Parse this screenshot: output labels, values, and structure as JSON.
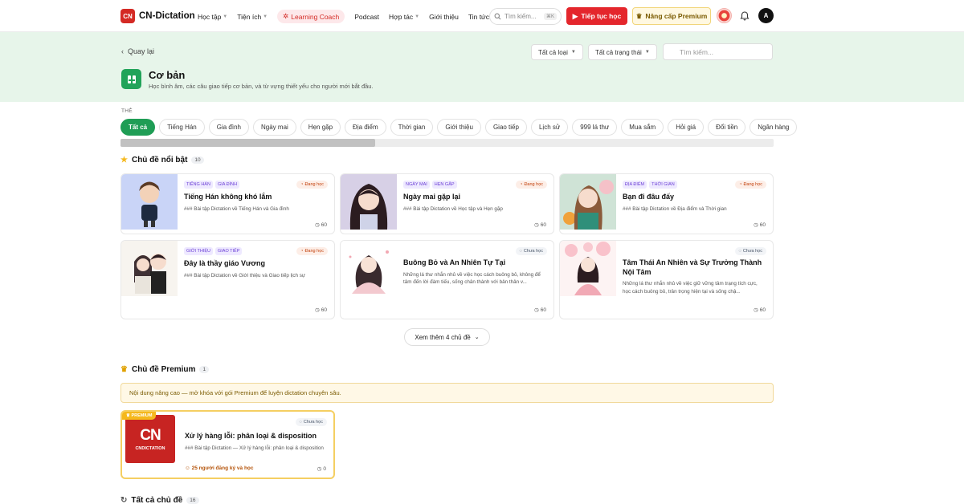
{
  "header": {
    "logo_mark": "CN",
    "brand": "CN-Dictation",
    "nav": [
      "Học tập",
      "Tiện ích",
      "Learning Coach",
      "Podcast",
      "Hợp tác",
      "Giới thiệu",
      "Tin tức"
    ],
    "search_placeholder": "Tìm kiếm...",
    "search_shortcut": "⌘K",
    "continue_label": "Tiếp tục học",
    "premium_label": "Nâng cấp Premium",
    "avatar_letter": "A"
  },
  "hero": {
    "back_label": "Quay lại",
    "filter_type": "Tất cả loại",
    "filter_status": "Tất cả trạng thái",
    "search_placeholder": "Tìm kiếm...",
    "title": "Cơ bản",
    "description": "Học bình âm, các câu giao tiếp cơ bản, và từ vựng thiết yếu cho người mới bắt đầu.",
    "accent": "#22a35a"
  },
  "tags": {
    "label": "THẺ",
    "items": [
      "Tất cả",
      "Tiếng Hán",
      "Gia đình",
      "Ngày mai",
      "Hẹn gặp",
      "Địa điểm",
      "Thời gian",
      "Giới thiệu",
      "Giao tiếp",
      "Lịch sử",
      "999 lá thư",
      "Mua sắm",
      "Hỏi giá",
      "Đổi tiền",
      "Ngân hàng"
    ]
  },
  "featured": {
    "title": "Chủ đề nổi bật",
    "count": "10",
    "cards": [
      {
        "chips": [
          "TIẾNG HÁN",
          "GIA ĐÌNH"
        ],
        "status": "Đang học",
        "title": "Tiếng Hán không khó lắm",
        "desc": "### Bài tập Dictation về Tiếng Hán và Gia đình",
        "count": "60"
      },
      {
        "chips": [
          "NGÀY MAI",
          "HẸN GẶP"
        ],
        "status": "Đang học",
        "title": "Ngày mai gặp lại",
        "desc": "### Bài tập Dictation về Học tập và Hẹn gặp",
        "count": "60"
      },
      {
        "chips": [
          "ĐỊA ĐIỂM",
          "THỜI GIAN"
        ],
        "status": "Đang học",
        "title": "Bạn đi đâu đấy",
        "desc": "### Bài tập Dictation về Địa điểm và Thời gian",
        "count": "60"
      },
      {
        "chips": [
          "GIỚI THIỆU",
          "GIAO TIẾP"
        ],
        "status": "Đang học",
        "title": "Đây là thầy giáo Vương",
        "desc": "### Bài tập Dictation về Giới thiệu và Giao tiếp lịch sự",
        "count": "60"
      },
      {
        "chips": [],
        "status": "Chưa học",
        "title": "Buông Bỏ và An Nhiên Tự Tại",
        "desc": "Những lá thư nhắn nhủ về việc học cách buông bỏ, không để tâm đến lời đàm tiếu, sống chân thành với bản thân v...",
        "count": "60"
      },
      {
        "chips": [],
        "status": "Chưa học",
        "title": "Tâm Thái An Nhiên và Sự Trưởng Thành Nội Tâm",
        "desc": "Những lá thư nhắn nhủ về việc giữ vững tâm trạng tích cực, học cách buông bỏ, trân trọng hiện tại và sống chậ...",
        "count": "60"
      }
    ],
    "more_label": "Xem thêm 4 chủ đề"
  },
  "premium": {
    "title": "Chủ đề Premium",
    "count": "1",
    "note": "Nội dung nâng cao — mở khóa với gói Premium để luyện dictation chuyên sâu.",
    "card": {
      "badge": "PREMIUM",
      "thumb_big": "CN",
      "thumb_small": "CNDICTATION",
      "status": "Chưa học",
      "title": "Xử lý hàng lỗi: phân loại & disposition",
      "desc": "### Bài tập Dictation — Xử lý hàng lỗi: phân loại & disposition",
      "enrolled": "25 người đăng ký và học",
      "count": "0"
    }
  },
  "all_topics": {
    "title": "Tất cả chủ đề",
    "count": "16"
  }
}
